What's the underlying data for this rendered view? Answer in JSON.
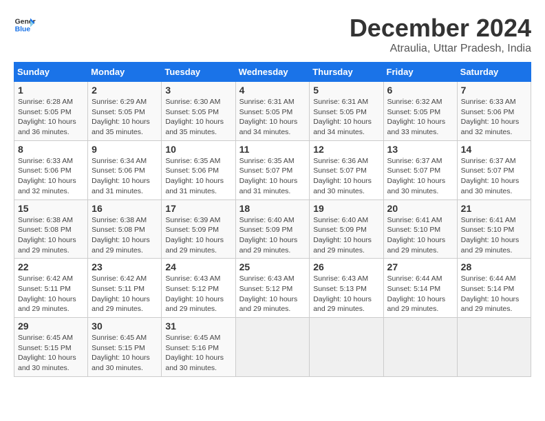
{
  "logo": {
    "line1": "General",
    "line2": "Blue"
  },
  "title": "December 2024",
  "subtitle": "Atraulia, Uttar Pradesh, India",
  "days_of_week": [
    "Sunday",
    "Monday",
    "Tuesday",
    "Wednesday",
    "Thursday",
    "Friday",
    "Saturday"
  ],
  "weeks": [
    [
      {
        "day": "1",
        "info": "Sunrise: 6:28 AM\nSunset: 5:05 PM\nDaylight: 10 hours\nand 36 minutes."
      },
      {
        "day": "2",
        "info": "Sunrise: 6:29 AM\nSunset: 5:05 PM\nDaylight: 10 hours\nand 35 minutes."
      },
      {
        "day": "3",
        "info": "Sunrise: 6:30 AM\nSunset: 5:05 PM\nDaylight: 10 hours\nand 35 minutes."
      },
      {
        "day": "4",
        "info": "Sunrise: 6:31 AM\nSunset: 5:05 PM\nDaylight: 10 hours\nand 34 minutes."
      },
      {
        "day": "5",
        "info": "Sunrise: 6:31 AM\nSunset: 5:05 PM\nDaylight: 10 hours\nand 34 minutes."
      },
      {
        "day": "6",
        "info": "Sunrise: 6:32 AM\nSunset: 5:05 PM\nDaylight: 10 hours\nand 33 minutes."
      },
      {
        "day": "7",
        "info": "Sunrise: 6:33 AM\nSunset: 5:06 PM\nDaylight: 10 hours\nand 32 minutes."
      }
    ],
    [
      {
        "day": "8",
        "info": "Sunrise: 6:33 AM\nSunset: 5:06 PM\nDaylight: 10 hours\nand 32 minutes."
      },
      {
        "day": "9",
        "info": "Sunrise: 6:34 AM\nSunset: 5:06 PM\nDaylight: 10 hours\nand 31 minutes."
      },
      {
        "day": "10",
        "info": "Sunrise: 6:35 AM\nSunset: 5:06 PM\nDaylight: 10 hours\nand 31 minutes."
      },
      {
        "day": "11",
        "info": "Sunrise: 6:35 AM\nSunset: 5:07 PM\nDaylight: 10 hours\nand 31 minutes."
      },
      {
        "day": "12",
        "info": "Sunrise: 6:36 AM\nSunset: 5:07 PM\nDaylight: 10 hours\nand 30 minutes."
      },
      {
        "day": "13",
        "info": "Sunrise: 6:37 AM\nSunset: 5:07 PM\nDaylight: 10 hours\nand 30 minutes."
      },
      {
        "day": "14",
        "info": "Sunrise: 6:37 AM\nSunset: 5:07 PM\nDaylight: 10 hours\nand 30 minutes."
      }
    ],
    [
      {
        "day": "15",
        "info": "Sunrise: 6:38 AM\nSunset: 5:08 PM\nDaylight: 10 hours\nand 29 minutes."
      },
      {
        "day": "16",
        "info": "Sunrise: 6:38 AM\nSunset: 5:08 PM\nDaylight: 10 hours\nand 29 minutes."
      },
      {
        "day": "17",
        "info": "Sunrise: 6:39 AM\nSunset: 5:09 PM\nDaylight: 10 hours\nand 29 minutes."
      },
      {
        "day": "18",
        "info": "Sunrise: 6:40 AM\nSunset: 5:09 PM\nDaylight: 10 hours\nand 29 minutes."
      },
      {
        "day": "19",
        "info": "Sunrise: 6:40 AM\nSunset: 5:09 PM\nDaylight: 10 hours\nand 29 minutes."
      },
      {
        "day": "20",
        "info": "Sunrise: 6:41 AM\nSunset: 5:10 PM\nDaylight: 10 hours\nand 29 minutes."
      },
      {
        "day": "21",
        "info": "Sunrise: 6:41 AM\nSunset: 5:10 PM\nDaylight: 10 hours\nand 29 minutes."
      }
    ],
    [
      {
        "day": "22",
        "info": "Sunrise: 6:42 AM\nSunset: 5:11 PM\nDaylight: 10 hours\nand 29 minutes."
      },
      {
        "day": "23",
        "info": "Sunrise: 6:42 AM\nSunset: 5:11 PM\nDaylight: 10 hours\nand 29 minutes."
      },
      {
        "day": "24",
        "info": "Sunrise: 6:43 AM\nSunset: 5:12 PM\nDaylight: 10 hours\nand 29 minutes."
      },
      {
        "day": "25",
        "info": "Sunrise: 6:43 AM\nSunset: 5:12 PM\nDaylight: 10 hours\nand 29 minutes."
      },
      {
        "day": "26",
        "info": "Sunrise: 6:43 AM\nSunset: 5:13 PM\nDaylight: 10 hours\nand 29 minutes."
      },
      {
        "day": "27",
        "info": "Sunrise: 6:44 AM\nSunset: 5:14 PM\nDaylight: 10 hours\nand 29 minutes."
      },
      {
        "day": "28",
        "info": "Sunrise: 6:44 AM\nSunset: 5:14 PM\nDaylight: 10 hours\nand 29 minutes."
      }
    ],
    [
      {
        "day": "29",
        "info": "Sunrise: 6:45 AM\nSunset: 5:15 PM\nDaylight: 10 hours\nand 30 minutes."
      },
      {
        "day": "30",
        "info": "Sunrise: 6:45 AM\nSunset: 5:15 PM\nDaylight: 10 hours\nand 30 minutes."
      },
      {
        "day": "31",
        "info": "Sunrise: 6:45 AM\nSunset: 5:16 PM\nDaylight: 10 hours\nand 30 minutes."
      },
      {
        "day": "",
        "info": ""
      },
      {
        "day": "",
        "info": ""
      },
      {
        "day": "",
        "info": ""
      },
      {
        "day": "",
        "info": ""
      }
    ]
  ]
}
